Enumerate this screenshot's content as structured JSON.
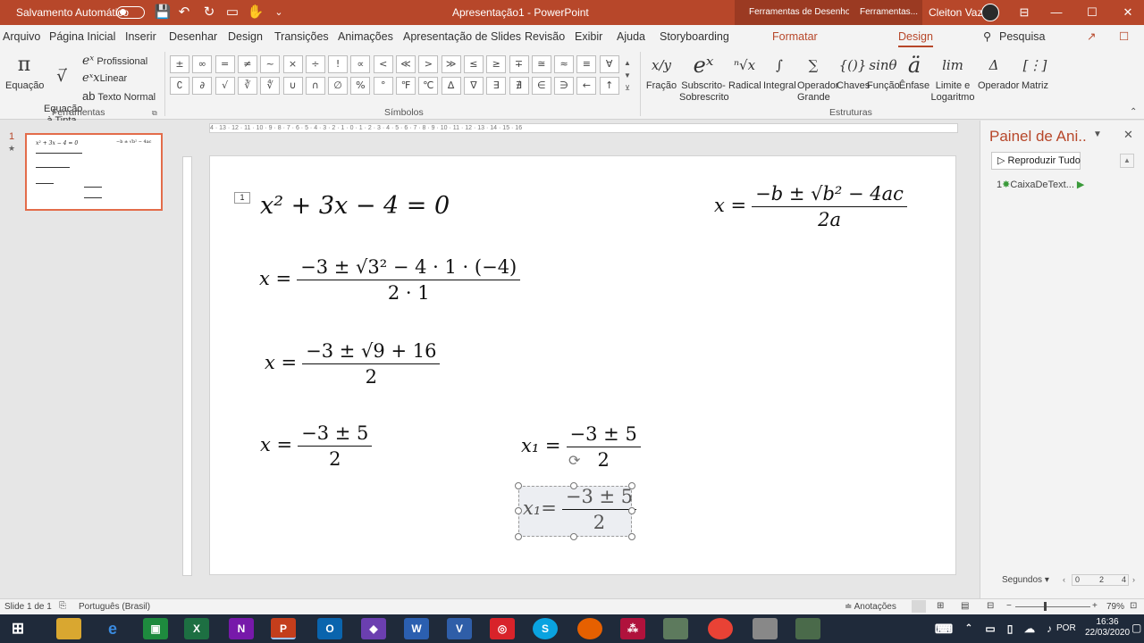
{
  "titlebar": {
    "autosave_label": "Salvamento Automático",
    "doc_title": "Apresentação1  -  PowerPoint",
    "context_tab_1": "Ferramentas de Desenho",
    "context_tab_2": "Ferramentas...",
    "user_name": "Cleiton Vaz",
    "qat": {
      "save": "💾",
      "undo": "↶",
      "redo": "↻",
      "present": "▭",
      "touch": "✋",
      "more": "⌄"
    },
    "win": {
      "ribbon": "⊟",
      "min": "—",
      "max": "☐",
      "close": "✕"
    }
  },
  "menu": {
    "tabs": [
      "Arquivo",
      "Página Inicial",
      "Inserir",
      "Desenhar",
      "Design",
      "Transições",
      "Animações",
      "Apresentação de Slides",
      "Revisão",
      "Exibir",
      "Ajuda",
      "Storyboarding",
      "Formatar",
      "Design"
    ],
    "search": "Pesquisa",
    "share_icon": "↗",
    "comment_icon": "☐"
  },
  "ribbon": {
    "ferramentas": {
      "equacao": "Equação",
      "equacao_tinta": "Equação\nà Tinta",
      "profissional": "Profissional",
      "linear": "Linear",
      "texto_normal": "Texto Normal",
      "label": "Ferramentas"
    },
    "simbolos": {
      "row1": [
        "±",
        "∞",
        "=",
        "≠",
        "~",
        "×",
        "÷",
        "!",
        "∝",
        "<",
        "≪",
        ">",
        "≫",
        "≤",
        "≥",
        "∓",
        "≅",
        "≈",
        "≡",
        "∀"
      ],
      "row2": [
        "∁",
        "∂",
        "√",
        "∛",
        "∜",
        "∪",
        "∩",
        "∅",
        "%",
        "°",
        "℉",
        "℃",
        "∆",
        "∇",
        "∃",
        "∄",
        "∈",
        "∋",
        "←",
        "↑"
      ],
      "label": "Símbolos"
    },
    "estruturas": {
      "buttons": [
        {
          "icon": "x/y",
          "label": "Fração"
        },
        {
          "icon": "eˣ",
          "label": "Subscrito-\nSobrescrito"
        },
        {
          "icon": "ⁿ√x",
          "label": "Radical"
        },
        {
          "icon": "∫",
          "label": "Integral"
        },
        {
          "icon": "∑",
          "label": "Operador\nGrande"
        },
        {
          "icon": "{()}",
          "label": "Chaves"
        },
        {
          "icon": "sinθ",
          "label": "Função"
        },
        {
          "icon": "ä",
          "label": "Ênfase"
        },
        {
          "icon": "lim",
          "label": "Limite e\nLogaritmo"
        },
        {
          "icon": "Δ",
          "label": "Operador"
        },
        {
          "icon": "[⋮]",
          "label": "Matriz"
        }
      ],
      "label": "Estruturas"
    }
  },
  "thumbnails": {
    "slide_number": "1",
    "star": "★"
  },
  "ruler": {
    "marks": "4 · 13 · 12 · 11 · 10 · 9 · 8 · 7 · 6 · 5 · 4 · 3 · 2 · 1 · 0 · 1 · 2 · 3 · 4 · 5 · 6 · 7 · 8 · 9 · 10 · 11 · 12 · 13 · 14 · 15 · 16"
  },
  "slide": {
    "anim_tag": "1",
    "eq1": "x² + 3x − 4 = 0",
    "eq2_lhs": "x =",
    "eq2_num": "−3 ± √3² − 4 · 1 · (−4)",
    "eq2_den": "2 · 1",
    "eq3_lhs": "x =",
    "eq3_num": "−3 ± √9 + 16",
    "eq3_den": "2",
    "eq4_lhs": "x =",
    "eq4_num": "−3 ± 5",
    "eq4_den": "2",
    "eq5_lhs": "x₁ =",
    "eq5_num": "−3 ± 5",
    "eq5_den": "2",
    "eq6_lhs": "x₁=",
    "eq6_num": "−3 ± 5",
    "eq6_den": "2",
    "formula_lhs": "x =",
    "formula_num": "−b ± √b² − 4ac",
    "formula_den": "2a"
  },
  "animation_pane": {
    "title": "Painel de Ani..",
    "play_all": "Reproduzir Tudo",
    "item_number": "1",
    "item_label": "CaixaDeText...",
    "seconds": "Segundos",
    "scale": [
      "0",
      "2",
      "4"
    ]
  },
  "status": {
    "slide": "Slide 1 de 1",
    "lang": "Português (Brasil)",
    "notes": "Anotações",
    "zoom": "79%"
  },
  "taskbar": {
    "time": "16:36",
    "date": "22/03/2020",
    "lang": "POR"
  }
}
